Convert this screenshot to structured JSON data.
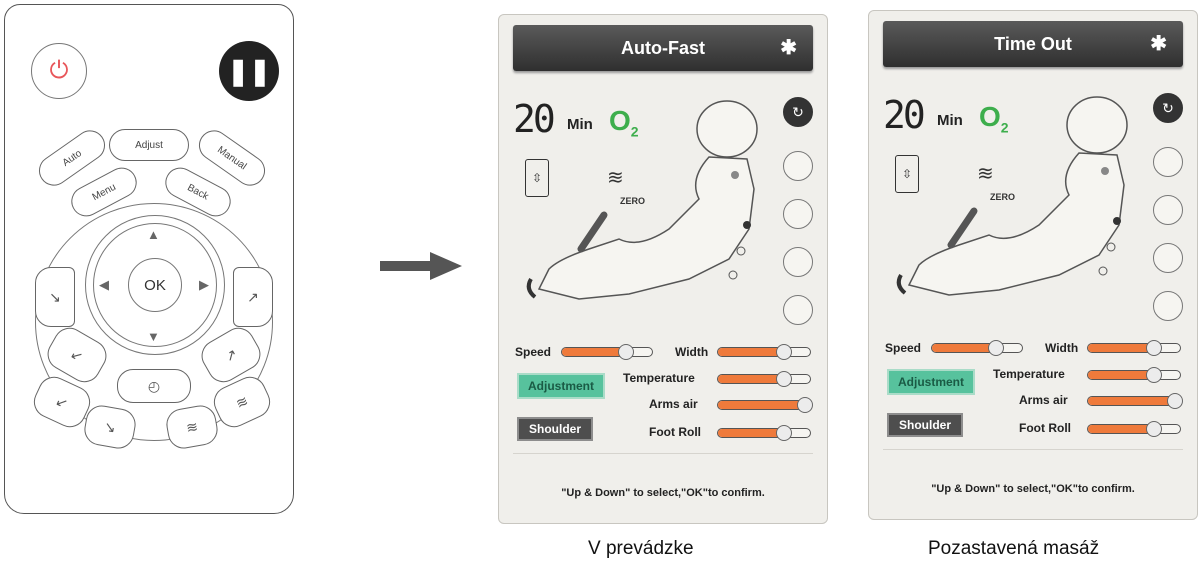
{
  "remote": {
    "power_icon": "power-icon",
    "pause_icon": "pause-icon",
    "buttons": {
      "adjust": "Adjust",
      "auto": "Auto",
      "manual": "Manual",
      "menu": "Menu",
      "back": "Back",
      "ok": "OK"
    }
  },
  "panels": [
    {
      "title": "Auto-Fast",
      "minutes": "20",
      "min_label": "Min",
      "o2": "O",
      "o2_sub": "2",
      "zero_label": "ZERO",
      "labels": {
        "speed": "Speed",
        "width": "Width",
        "temperature": "Temperature",
        "arms_air": "Arms air",
        "foot_roll": "Foot Roll",
        "adjustment": "Adjustment",
        "shoulder": "Shoulder"
      },
      "levels": {
        "speed": 0.72,
        "width": 0.72,
        "temperature": 0.72,
        "arms_air": 0.95,
        "foot_roll": 0.72
      },
      "footer": "\"Up & Down\" to select,\"OK\"to confirm.",
      "caption": "V prevádzke"
    },
    {
      "title": "Time Out",
      "minutes": "20",
      "min_label": "Min",
      "o2": "O",
      "o2_sub": "2",
      "zero_label": "ZERO",
      "labels": {
        "speed": "Speed",
        "width": "Width",
        "temperature": "Temperature",
        "arms_air": "Arms air",
        "foot_roll": "Foot Roll",
        "adjustment": "Adjustment",
        "shoulder": "Shoulder"
      },
      "levels": {
        "speed": 0.72,
        "width": 0.72,
        "temperature": 0.72,
        "arms_air": 0.95,
        "foot_roll": 0.72
      },
      "footer": "\"Up & Down\" to select,\"OK\"to confirm.",
      "caption": "Pozastavená masáž"
    }
  ],
  "colors": {
    "slider_fill": "#ef7a3b",
    "adjust_button": "#57c29d",
    "o2": "#3dae4c"
  }
}
